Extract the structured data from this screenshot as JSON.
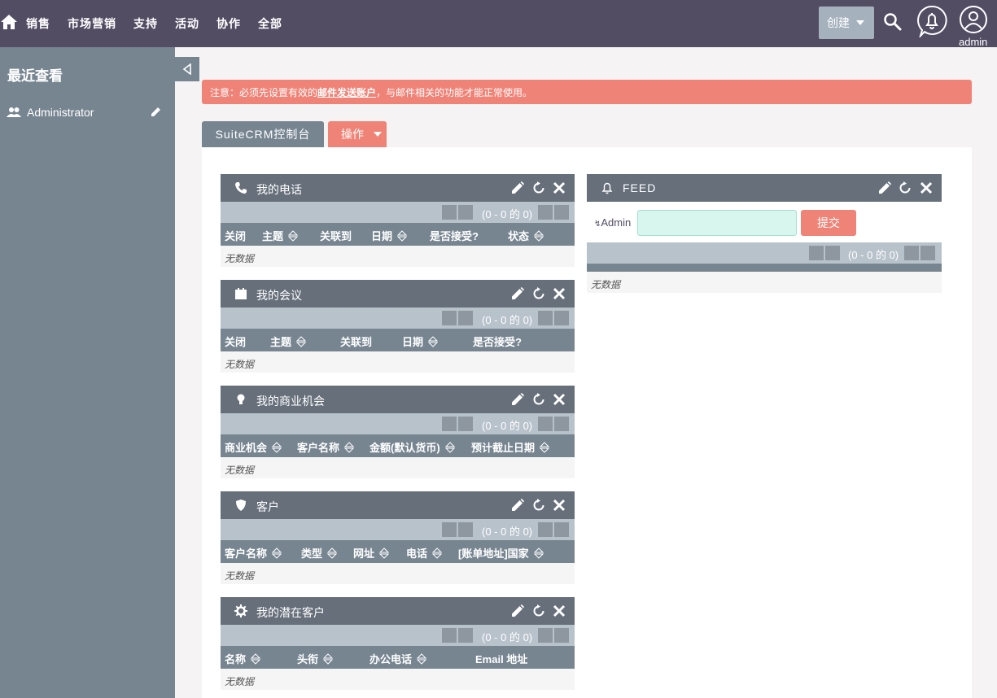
{
  "topnav": {
    "items": [
      "销售",
      "市场营销",
      "支持",
      "活动",
      "协作",
      "全部"
    ],
    "create_label": "创建",
    "user_label": "admin"
  },
  "sidebar": {
    "title": "最近查看",
    "recent_items": [
      {
        "label": "Administrator"
      }
    ]
  },
  "alert": {
    "prefix": "注意：必须先设置有效的",
    "link": "邮件发送账户",
    "suffix": "，与邮件相关的功能才能正常使用。"
  },
  "dashboard": {
    "tab_label": "SuiteCRM控制台",
    "action_label": "操作"
  },
  "pager_text": "(0 - 0 的 0)",
  "no_data": "无数据",
  "dashlets": [
    {
      "title": "我的电话",
      "icon": "phone-icon",
      "columns": [
        {
          "label": "关闭",
          "sortable": false
        },
        {
          "label": "主题",
          "sortable": true
        },
        {
          "label": "关联到",
          "sortable": false
        },
        {
          "label": "日期",
          "sortable": true
        },
        {
          "label": "是否接受?",
          "sortable": false
        },
        {
          "label": "状态",
          "sortable": true
        }
      ]
    },
    {
      "title": "我的会议",
      "icon": "calendar-icon",
      "columns": [
        {
          "label": "关闭",
          "sortable": false
        },
        {
          "label": "主题",
          "sortable": true
        },
        {
          "label": "关联到",
          "sortable": false
        },
        {
          "label": "日期",
          "sortable": true
        },
        {
          "label": "是否接受?",
          "sortable": false
        }
      ]
    },
    {
      "title": "我的商业机会",
      "icon": "lightbulb-icon",
      "columns": [
        {
          "label": "商业机会",
          "sortable": true
        },
        {
          "label": "客户名称",
          "sortable": true
        },
        {
          "label": "金额(默认货币)",
          "sortable": true
        },
        {
          "label": "预计截止日期",
          "sortable": true
        }
      ]
    },
    {
      "title": "客户",
      "icon": "shield-icon",
      "columns": [
        {
          "label": "客户名称",
          "sortable": true
        },
        {
          "label": "类型",
          "sortable": true
        },
        {
          "label": "网址",
          "sortable": true
        },
        {
          "label": "电话",
          "sortable": true
        },
        {
          "label": "[账单地址]国家",
          "sortable": true
        }
      ]
    },
    {
      "title": "我的潜在客户",
      "icon": "gear-icon",
      "columns": [
        {
          "label": "名称",
          "sortable": true
        },
        {
          "label": "头衔",
          "sortable": true
        },
        {
          "label": "办公电话",
          "sortable": true
        },
        {
          "label": "Email 地址",
          "sortable": false
        }
      ]
    }
  ],
  "feed": {
    "title": "FEED",
    "user": "Admin",
    "submit_label": "提交"
  }
}
